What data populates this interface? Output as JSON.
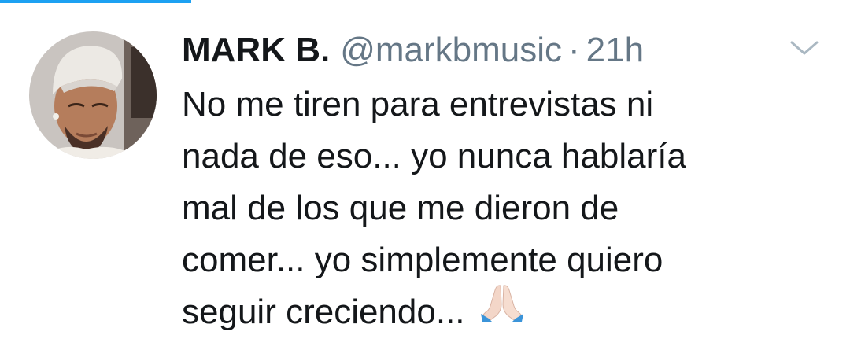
{
  "tweet": {
    "author_name": "MARK B.",
    "handle": "@markbmusic",
    "separator": "·",
    "time": "21h",
    "text_lines": [
      "No me tiren para entrevistas ni",
      "nada de eso... yo nunca hablaría",
      "mal de los que me dieron de",
      "comer... yo simplemente quiero",
      "seguir creciendo..."
    ],
    "emoji": "folded-hands-light-skin-tone",
    "menu_icon": "chevron-down-icon"
  },
  "colors": {
    "accent": "#1da1f2",
    "text_primary": "#14171a",
    "text_secondary": "#657786",
    "caret": "#aab8c2"
  }
}
